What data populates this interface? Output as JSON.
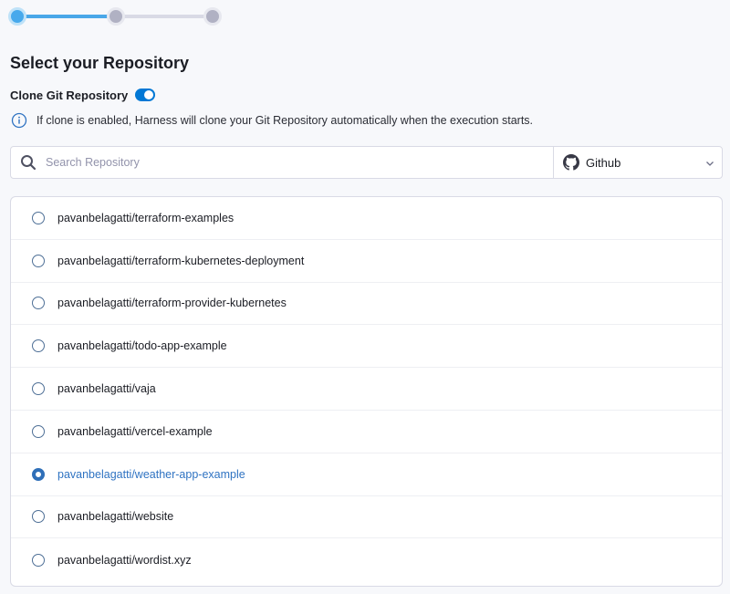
{
  "stepper": {
    "current_step": 1,
    "total_steps": 3
  },
  "title": "Select your Repository",
  "clone": {
    "label": "Clone Git Repository",
    "enabled": true
  },
  "info": {
    "icon": "info-icon",
    "text": "If clone is enabled, Harness will clone your Git Repository automatically when the execution starts."
  },
  "search": {
    "placeholder": "Search Repository",
    "value": ""
  },
  "provider": {
    "icon": "github-icon",
    "selected": "Github"
  },
  "colors": {
    "accent": "#2f73c2",
    "toggle": "#0278d5",
    "step_active": "#47a9ec"
  },
  "repositories": [
    {
      "name": "pavanbelagatti/terraform-examples",
      "selected": false
    },
    {
      "name": "pavanbelagatti/terraform-kubernetes-deployment",
      "selected": false
    },
    {
      "name": "pavanbelagatti/terraform-provider-kubernetes",
      "selected": false
    },
    {
      "name": "pavanbelagatti/todo-app-example",
      "selected": false
    },
    {
      "name": "pavanbelagatti/vaja",
      "selected": false
    },
    {
      "name": "pavanbelagatti/vercel-example",
      "selected": false
    },
    {
      "name": "pavanbelagatti/weather-app-example",
      "selected": true
    },
    {
      "name": "pavanbelagatti/website",
      "selected": false
    },
    {
      "name": "pavanbelagatti/wordist.xyz",
      "selected": false
    }
  ]
}
